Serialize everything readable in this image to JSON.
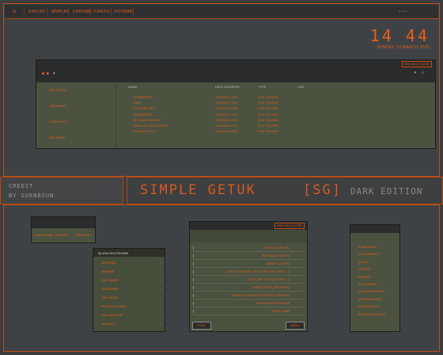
{
  "taskbar": {
    "menu": [
      "EXPLRC",
      "WNPLAY",
      "CHROME",
      "FIREFX",
      "FOOBAR"
    ],
    "right": "• • •"
  },
  "clock": {
    "time": "14 44",
    "date": "SUNDAY, 10 MARCH 2013"
  },
  "explorer": {
    "caption": "MIN  MAX  CLOSE",
    "sidebar": [
      "FAVORITES",
      "LIBRARIES",
      "COMPUTER",
      "NETWORK"
    ],
    "columns": [
      "NAME",
      "DATE MODIFIED",
      "TYPE",
      "SIZE"
    ],
    "files": [
      {
        "name": "7COMPRESS",
        "date": "11/3/2013 12:51",
        "type": "FILE FOLDER"
      },
      {
        "name": "FONT",
        "date": "11/3/2013 12:51",
        "type": "FILE FOLDER"
      },
      {
        "name": "ICON PROJECT",
        "date": "11/3/2013 12:51",
        "type": "FILE FOLDER"
      },
      {
        "name": "RAINMETER",
        "date": "11/3/2013 12:51",
        "type": "FILE FOLDER"
      },
      {
        "name": "SETTING BUILDER",
        "date": "11/3/2013 12:51",
        "type": "FILE FOLDER"
      },
      {
        "name": "TOGGLE CUSTOMIZER",
        "date": "11/3/2013 12:51",
        "type": "FILE FOLDER"
      },
      {
        "name": "VISUAL STYLE",
        "date": "11/3/2013 12:51",
        "type": "FILE FOLDER"
      }
    ]
  },
  "credit": {
    "line1": "CREDIT",
    "line2": "BY  SUKNBSUN"
  },
  "banner": {
    "title": "SIMPLE GETUK",
    "tag": "[SG]",
    "edition": "DARK EDITION"
  },
  "logoff_win": {
    "buttons": [
      "SHUTDOWN",
      "LOGOFF",
      "RESTART"
    ]
  },
  "start_menu": {
    "header": "MLANA  SHUTDOWN",
    "items": [
      "NOTEPAD",
      "WINAMP",
      "SKETCHER",
      "IRFANVIEW",
      "SNIT SHOT",
      "PROCESS EXPL",
      "CALCULATOR",
      "UNDOCK"
    ]
  },
  "player": {
    "caption": "MIN  MAX  CLOSE",
    "tracks": [
      "THE CLIX (BLUE)",
      "BIRTHDAY HAVEN",
      "I WANT YA GIRL",
      "ONLY POSITIVE ON YOUR SIDE (FEAT. ...)",
      "JUST LIKE THAT (ACTIVE ...)",
      "THESE DAYS (RAVE MIX)",
      "WHEN TO SHINE ACOUSTIC VERSION",
      "SUNDAY AFTERNOON",
      "GOOD TIME"
    ],
    "play": "PLAY",
    "menu": "MENU"
  },
  "side_menu": {
    "items": [
      "COMPUTER",
      "DOCUMENTS",
      "MUSIC",
      "VIDEOS",
      "IMAGES",
      "PROGRAMS",
      "CUSTOMIZATION",
      "APPLICATIONS",
      "DOWNLOADS",
      "MISCELLANEOUS"
    ]
  },
  "colors": {
    "accent": "#e6601c",
    "window": "#4b5240",
    "titlebar": "#2b2c2d",
    "background": "#3b3d3f"
  }
}
